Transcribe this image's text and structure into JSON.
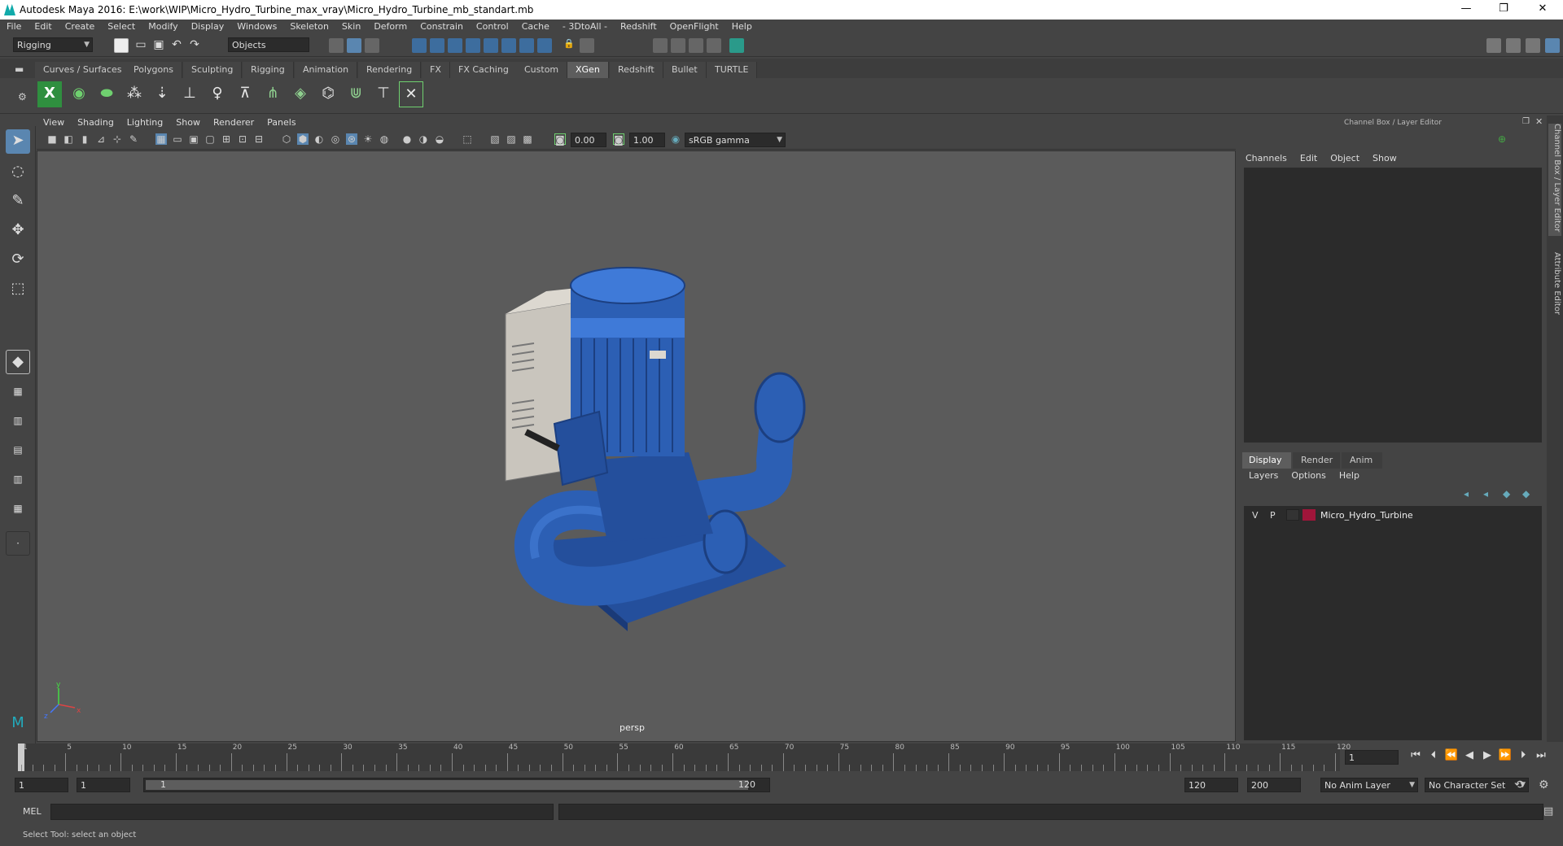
{
  "window": {
    "title": "Autodesk Maya 2016: E:\\work\\WIP\\Micro_Hydro_Turbine_max_vray\\Micro_Hydro_Turbine_mb_standart.mb",
    "minimize": "—",
    "restore": "❐",
    "close": "✕"
  },
  "menubar": [
    "File",
    "Edit",
    "Create",
    "Select",
    "Modify",
    "Display",
    "Windows",
    "Skeleton",
    "Skin",
    "Deform",
    "Constrain",
    "Control",
    "Cache",
    "- 3DtoAll -",
    "Redshift",
    "OpenFlight",
    "Help"
  ],
  "statusline": {
    "mode": "Rigging",
    "selection_mode": "Objects"
  },
  "shelf_tabs": [
    "Curves / Surfaces",
    "Polygons",
    "Sculpting",
    "Rigging",
    "Animation",
    "Rendering",
    "FX",
    "FX Caching",
    "Custom",
    "XGen",
    "Redshift",
    "Bullet",
    "TURTLE"
  ],
  "shelf_active": "XGen",
  "shelf_icons": [
    "xgen-logo-icon",
    "xgen-eye-icon",
    "xgen-leaf-icon",
    "add-guide-icon",
    "move-guide-icon",
    "cv-guide-icon",
    "sculpt-guide-icon",
    "lock-guide-icon",
    "grass-icon",
    "grid-icon",
    "rig-guide-icon",
    "hair-icon",
    "comb-icon",
    "xgen-select-icon"
  ],
  "panel_menu": [
    "View",
    "Shading",
    "Lighting",
    "Show",
    "Renderer",
    "Panels"
  ],
  "panel_toolbar": {
    "field_a": "0.00",
    "field_b": "1.00",
    "color_space": "sRGB gamma"
  },
  "viewport": {
    "camera_label": "persp",
    "axis_x": "x",
    "axis_y": "y",
    "axis_z": "z",
    "model_colors": {
      "body": "#2c5fb4",
      "highlight": "#3f7ad8",
      "shadow": "#1c3f80",
      "box": "#c9c5bd"
    }
  },
  "right_panel": {
    "header": "Channel Box / Layer Editor",
    "menu": [
      "Channels",
      "Edit",
      "Object",
      "Show"
    ],
    "layer_tabs": [
      "Display",
      "Render",
      "Anim"
    ],
    "layer_tab_active": "Display",
    "layer_menu": [
      "Layers",
      "Options",
      "Help"
    ],
    "layers": [
      {
        "v": "V",
        "p": "P",
        "color": "#a0153a",
        "name": "Micro_Hydro_Turbine"
      }
    ]
  },
  "side_tabs": [
    "Channel Box / Layer Editor",
    "Attribute Editor"
  ],
  "timeline": {
    "ticks": [
      "1",
      "5",
      "10",
      "15",
      "20",
      "25",
      "30",
      "35",
      "40",
      "45",
      "50",
      "55",
      "60",
      "65",
      "70",
      "75",
      "80",
      "85",
      "90",
      "95",
      "100",
      "105",
      "110",
      "115",
      "120"
    ],
    "current_frame": "1"
  },
  "range": {
    "start": "1",
    "playback_start": "1",
    "slider_start": "1",
    "slider_end": "120",
    "playback_end": "120",
    "end": "200",
    "anim_layer": "No Anim Layer",
    "character_set": "No Character Set"
  },
  "cmdline": {
    "label": "MEL"
  },
  "helpline": {
    "text": "Select Tool: select an object"
  }
}
